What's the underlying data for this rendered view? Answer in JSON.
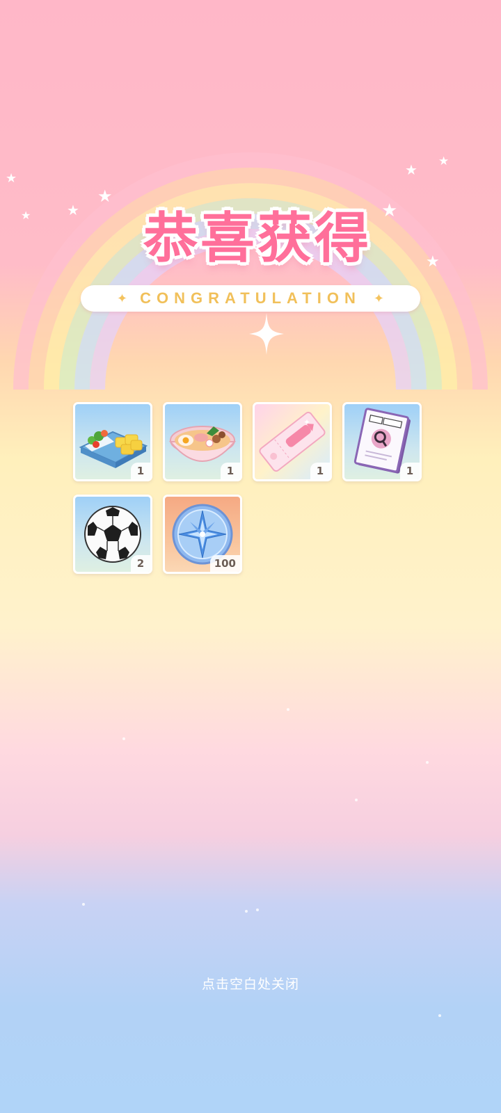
{
  "title": "恭喜获得",
  "subtitle": "CONGRATULATION",
  "rewards": [
    {
      "icon": "bento-box-icon",
      "qty": "1"
    },
    {
      "icon": "ramen-bowl-icon",
      "qty": "1"
    },
    {
      "icon": "ticket-icon",
      "qty": "1"
    },
    {
      "icon": "book-icon",
      "qty": "1"
    },
    {
      "icon": "soccer-ball-icon",
      "qty": "2"
    },
    {
      "icon": "compass-coin-icon",
      "qty": "100"
    }
  ],
  "close_hint": "点击空白处关闭",
  "colors": {
    "title": "#ff6f9a",
    "subtitle": "#f1c05a",
    "hint": "#ffffff"
  }
}
